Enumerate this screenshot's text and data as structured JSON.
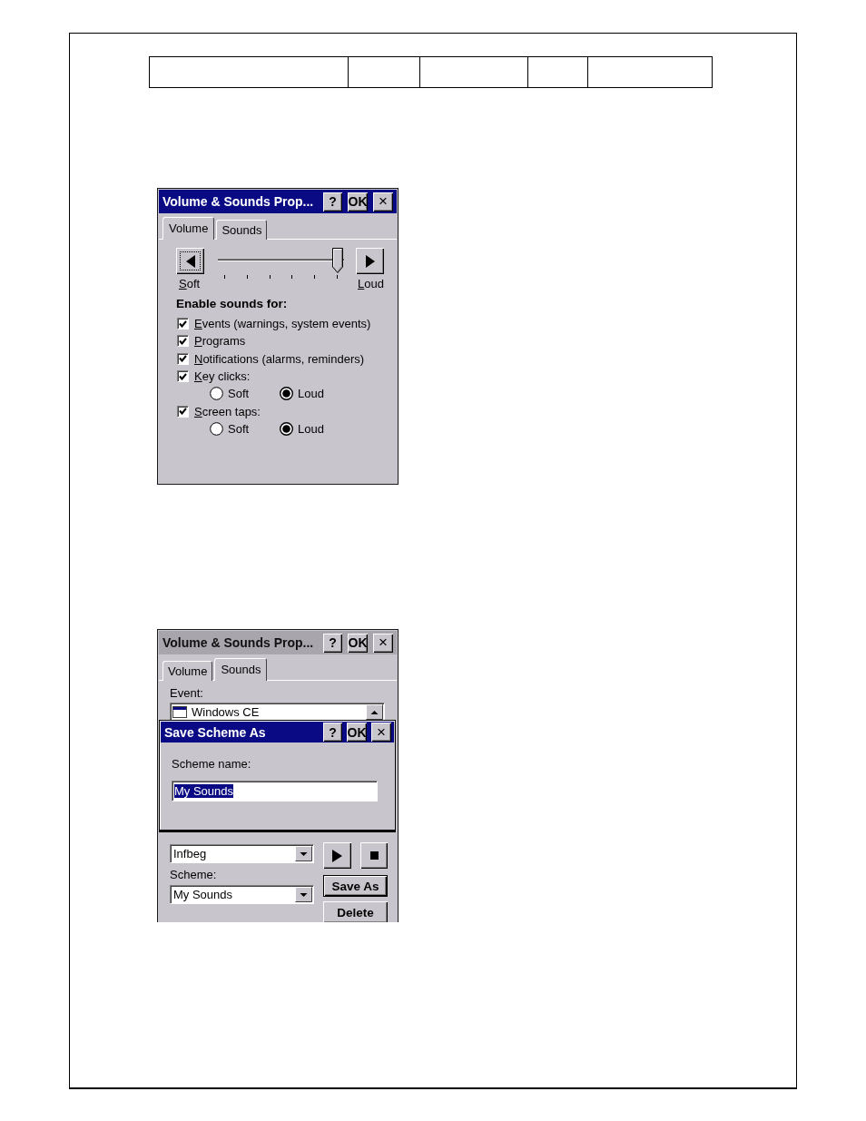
{
  "volume_dialog": {
    "title": "Volume & Sounds Prop...",
    "active": true,
    "title_buttons": [
      {
        "kind": "help",
        "label": "?"
      },
      {
        "kind": "ok",
        "label": "OK"
      },
      {
        "kind": "close",
        "label": "×"
      }
    ],
    "tabs": [
      {
        "label": "Volume",
        "selected": true
      },
      {
        "label": "Sounds",
        "selected": false
      }
    ],
    "slider": {
      "level": 1,
      "decrease_focused": true,
      "min_label": {
        "text": "Soft",
        "access_key_underlined": true
      },
      "max_label": {
        "text": "Loud",
        "access_key_underlined": true
      }
    },
    "section_label": "Enable sounds for:",
    "options": [
      {
        "kind": "checkbox",
        "label": "Events (warnings, system events)",
        "checked": true,
        "access_key_underlined": true
      },
      {
        "kind": "checkbox",
        "label": "Programs",
        "checked": true,
        "access_key_underlined": true
      },
      {
        "kind": "checkbox",
        "label": "Notifications (alarms, reminders)",
        "checked": true,
        "access_key_underlined": true
      },
      {
        "kind": "checkbox",
        "label": "Key clicks:",
        "checked": true,
        "access_key_underlined": true
      },
      {
        "kind": "radio_group",
        "choices": [
          {
            "label": "Soft",
            "selected": false
          },
          {
            "label": "Loud",
            "selected": true
          }
        ]
      },
      {
        "kind": "checkbox",
        "label": "Screen taps:",
        "checked": true,
        "access_key_underlined": true
      },
      {
        "kind": "radio_group",
        "choices": [
          {
            "label": "Soft",
            "selected": false
          },
          {
            "label": "Loud",
            "selected": true
          }
        ]
      }
    ]
  },
  "sounds_dialog": {
    "title": "Volume & Sounds Prop...",
    "active": false,
    "title_buttons": [
      {
        "kind": "help",
        "label": "?"
      },
      {
        "kind": "ok",
        "label": "OK"
      },
      {
        "kind": "close",
        "label": "×"
      }
    ],
    "tabs": [
      {
        "label": "Volume",
        "selected": false
      },
      {
        "label": "Sounds",
        "selected": true
      }
    ],
    "event_label": "Event:",
    "event_list": [
      {
        "label": "Windows CE"
      }
    ],
    "sound_value": "Infbeg",
    "scheme_label": "Scheme:",
    "scheme_value": "My Sounds",
    "buttons": [
      {
        "label": "Save As",
        "default": true
      },
      {
        "label": "Delete",
        "default": false
      }
    ]
  },
  "save_scheme_dialog": {
    "title": "Save Scheme As",
    "active": true,
    "title_buttons": [
      {
        "kind": "help",
        "label": "?"
      },
      {
        "kind": "ok",
        "label": "OK"
      },
      {
        "kind": "close",
        "label": "×"
      }
    ],
    "field_label": "Scheme name:",
    "field_value": "My Sounds",
    "value_selected": true
  }
}
